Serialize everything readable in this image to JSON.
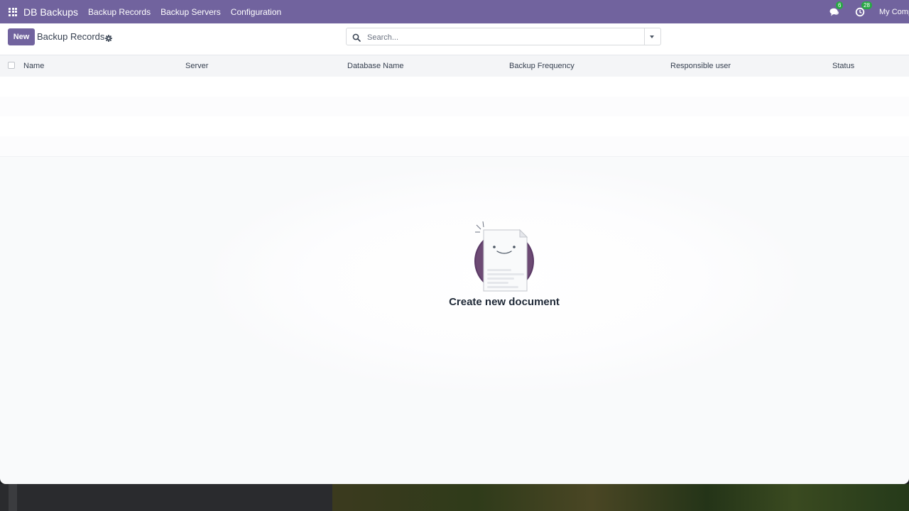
{
  "app": {
    "name": "DB Backups",
    "menu": [
      "Backup Records",
      "Backup Servers",
      "Configuration"
    ],
    "messages_count": "6",
    "activities_count": "28",
    "company": "My Comp"
  },
  "control_panel": {
    "new_button": "New",
    "breadcrumb": "Backup Records",
    "search_placeholder": "Search..."
  },
  "list": {
    "columns": [
      "Name",
      "Server",
      "Database Name",
      "Backup Frequency",
      "Responsible user",
      "Status"
    ],
    "rows": []
  },
  "empty_state": {
    "title": "Create new document"
  },
  "colors": {
    "brand": "#71639e",
    "badge": "#28a745"
  }
}
